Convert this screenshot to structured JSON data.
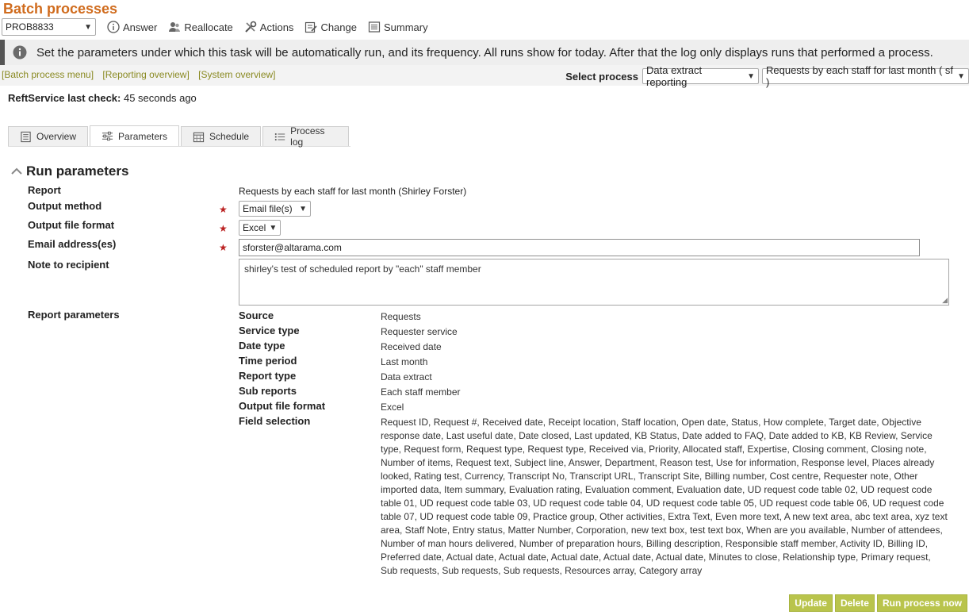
{
  "page": {
    "title": "Batch processes"
  },
  "toolbar": {
    "ticket": "PROB8833",
    "answer": "Answer",
    "reallocate": "Reallocate",
    "actions": "Actions",
    "change": "Change",
    "summary": "Summary"
  },
  "info": {
    "text": "Set the parameters under which this task will be automatically run, and its frequency. All runs show for today. After that the log only displays runs that performed a process."
  },
  "nav": {
    "batch_menu": "[Batch process menu]",
    "reporting": "[Reporting overview]",
    "system": "[System overview]",
    "select_label": "Select process",
    "process_type": "Data extract reporting",
    "process_name": "Requests by each staff for last month ( sf )"
  },
  "service": {
    "label": "ReftService last check:",
    "value": "45 seconds ago"
  },
  "tabs": {
    "overview": "Overview",
    "parameters": "Parameters",
    "schedule": "Schedule",
    "log": "Process log"
  },
  "section": {
    "title": "Run parameters"
  },
  "form": {
    "report_label": "Report",
    "report_value": "Requests by each staff for last month (Shirley Forster)",
    "output_method_label": "Output method",
    "output_method_value": "Email file(s)",
    "file_format_label": "Output file format",
    "file_format_value": "Excel",
    "email_label": "Email address(es)",
    "email_value": "sforster@altarama.com",
    "note_label": "Note to recipient",
    "note_value": "shirley's test of scheduled report by \"each\" staff member",
    "report_params_label": "Report parameters"
  },
  "params": [
    {
      "key": "Source",
      "value": "Requests"
    },
    {
      "key": "Service type",
      "value": "Requester service"
    },
    {
      "key": "Date type",
      "value": "Received date"
    },
    {
      "key": "Time period",
      "value": "Last month"
    },
    {
      "key": "Report type",
      "value": "Data extract"
    },
    {
      "key": "Sub reports",
      "value": "Each staff member"
    },
    {
      "key": "Output file format",
      "value": "Excel"
    },
    {
      "key": "Field selection",
      "value": "Request ID, Request #, Received date, Receipt location, Staff location, Open date, Status, How complete, Target date, Objective response date, Last useful date, Date closed, Last updated, KB Status, Date added to FAQ, Date added to KB, KB Review, Service type, Request form, Request type, Request type, Received via, Priority, Allocated staff, Expertise, Closing comment, Closing note, Number of items, Request text, Subject line, Answer, Department, Reason test, Use for information, Response level, Places already looked, Rating test, Currency, Transcript No, Transcript URL, Transcript Site, Billing number, Cost centre, Requester note, Other imported data, Item summary, Evaluation rating, Evaluation comment, Evaluation date, UD request code table 02, UD request code table 01, UD request code table 03, UD request code table 04, UD request code table 05, UD request code table 06, UD request code table 07, UD request code table 09, Practice group, Other activities, Extra Text, Even more text, A new text area, abc text area, xyz text area, Staff Note, Entry status, Matter Number, Corporation, new text box, test text box, When are you available, Number of attendees, Number of man hours delivered, Number of preparation hours, Billing description, Responsible staff member, Activity ID, Billing ID, Preferred date, Actual date, Actual date, Actual date, Actual date, Actual date, Minutes to close, Relationship type, Primary request, Sub requests, Sub requests, Sub requests, Resources array, Category array"
    }
  ],
  "buttons": {
    "update": "Update",
    "delete": "Delete",
    "run": "Run process now"
  }
}
